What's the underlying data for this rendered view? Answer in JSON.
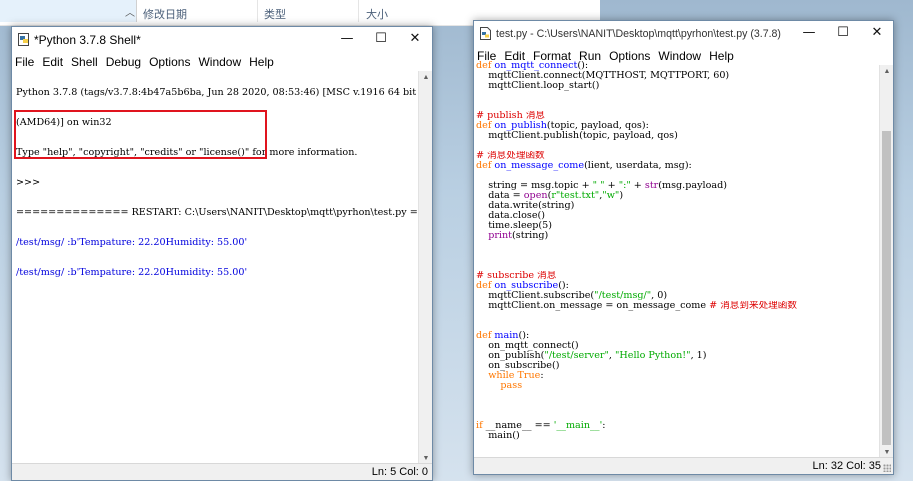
{
  "explorer": {
    "columns": [
      "修改日期",
      "类型",
      "大小"
    ]
  },
  "shell": {
    "title": "*Python 3.7.8 Shell*",
    "menu": [
      "File",
      "Edit",
      "Shell",
      "Debug",
      "Options",
      "Window",
      "Help"
    ],
    "lines": [
      "Python 3.7.8 (tags/v3.7.8:4b47a5b6ba, Jun 28 2020, 08:53:46) [MSC v.1916 64 bit",
      "(AMD64)] on win32",
      "Type \"help\", \"copyright\", \"credits\" or \"license()\" for more information.",
      ">>> ",
      "============== RESTART: C:\\Users\\NANIT\\Desktop\\mqtt\\pyrhon\\test.py ==============",
      "/test/msg/ :b'Tempature: 22.20Humidity: 55.00'",
      "/test/msg/ :b'Tempature: 22.20Humidity: 55.00'"
    ],
    "status": "Ln: 5   Col: 0"
  },
  "editor": {
    "title": "test.py - C:\\Users\\NANIT\\Desktop\\mqtt\\pyrhon\\test.py (3.7.8)",
    "menu": [
      "File",
      "Edit",
      "Format",
      "Run",
      "Options",
      "Window",
      "Help"
    ],
    "code": [
      [
        [
          "def ",
          "kw"
        ],
        [
          "on_mqtt_connect",
          "fn"
        ],
        [
          "():",
          "blk"
        ]
      ],
      [
        [
          "    mqttClient.connect(MQTTHOST, MQTTPORT, 60)",
          "blk"
        ]
      ],
      [
        [
          "    mqttClient.loop_start()",
          "blk"
        ]
      ],
      [],
      [],
      [
        [
          "# publish 消息",
          "cmt"
        ]
      ],
      [
        [
          "def ",
          "kw"
        ],
        [
          "on_publish",
          "fn"
        ],
        [
          "(topic, payload, qos):",
          "blk"
        ]
      ],
      [
        [
          "    mqttClient.publish(topic, payload, qos)",
          "blk"
        ]
      ],
      [],
      [
        [
          "# 消息处理函数",
          "cmt"
        ]
      ],
      [
        [
          "def ",
          "kw"
        ],
        [
          "on_message_come",
          "fn"
        ],
        [
          "(lient, userdata, msg):",
          "blk"
        ]
      ],
      [],
      [
        [
          "    string = msg.topic + ",
          "blk"
        ],
        [
          "\" \"",
          "str"
        ],
        [
          " + ",
          "blk"
        ],
        [
          "\":\"",
          "str"
        ],
        [
          " + ",
          "blk"
        ],
        [
          "str",
          "bi"
        ],
        [
          "(msg.payload)",
          "blk"
        ]
      ],
      [
        [
          "    data = ",
          "blk"
        ],
        [
          "open",
          "bi"
        ],
        [
          "(",
          "blk"
        ],
        [
          "r\"test.txt\"",
          "str"
        ],
        [
          ",",
          "blk"
        ],
        [
          "\"w\"",
          "str"
        ],
        [
          ")",
          "blk"
        ]
      ],
      [
        [
          "    data.write(string)",
          "blk"
        ]
      ],
      [
        [
          "    data.close()",
          "blk"
        ]
      ],
      [
        [
          "    time.sleep(5)",
          "blk"
        ]
      ],
      [
        [
          "    ",
          "blk"
        ],
        [
          "print",
          "bi"
        ],
        [
          "(string)",
          "blk"
        ]
      ],
      [],
      [],
      [],
      [
        [
          "# subscribe 消息",
          "cmt"
        ]
      ],
      [
        [
          "def ",
          "kw"
        ],
        [
          "on_subscribe",
          "fn"
        ],
        [
          "():",
          "blk"
        ]
      ],
      [
        [
          "    mqttClient.subscribe(",
          "blk"
        ],
        [
          "\"/test/msg/\"",
          "str"
        ],
        [
          ", 0)",
          "blk"
        ]
      ],
      [
        [
          "    mqttClient.on_message = on_message_come ",
          "blk"
        ],
        [
          "# 消息到来处理函数",
          "cmt"
        ]
      ],
      [],
      [],
      [
        [
          "def ",
          "kw"
        ],
        [
          "main",
          "fn"
        ],
        [
          "():",
          "blk"
        ]
      ],
      [
        [
          "    on_mqtt_connect()",
          "blk"
        ]
      ],
      [
        [
          "    on_publish(",
          "blk"
        ],
        [
          "\"/test/server\"",
          "str"
        ],
        [
          ", ",
          "blk"
        ],
        [
          "\"Hello Python!\"",
          "str"
        ],
        [
          ", 1)",
          "blk"
        ]
      ],
      [
        [
          "    on_subscribe()",
          "blk"
        ]
      ],
      [
        [
          "    ",
          "blk"
        ],
        [
          "while True",
          "kw"
        ],
        [
          ":",
          "blk"
        ]
      ],
      [
        [
          "        ",
          "blk"
        ],
        [
          "pass",
          "kw"
        ]
      ],
      [],
      [],
      [],
      [
        [
          "if",
          "kw"
        ],
        [
          " __name__ == ",
          "blk"
        ],
        [
          "'__main__'",
          "str"
        ],
        [
          ":",
          "blk"
        ]
      ],
      [
        [
          "    main()",
          "blk"
        ]
      ]
    ],
    "status": "Ln: 32   Col: 35"
  }
}
